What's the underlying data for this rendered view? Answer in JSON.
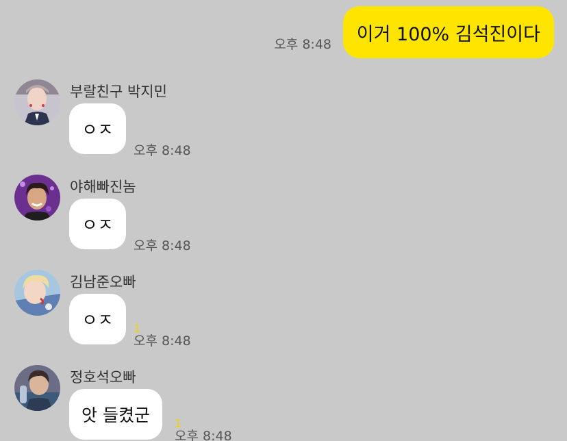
{
  "my_message": {
    "text": "이거 100% 김석진이다",
    "time": "오후 8:48"
  },
  "messages": [
    {
      "sender": "부랄친구 박지민",
      "text": "ㅇㅈ",
      "time": "오후 8:48",
      "unread": ""
    },
    {
      "sender": "야해빠진놈",
      "text": "ㅇㅈ",
      "time": "오후 8:48",
      "unread": ""
    },
    {
      "sender": "김남준오빠",
      "text": "ㅇㅈ",
      "time": "오후 8:48",
      "unread": "1"
    },
    {
      "sender": "정호석오빠",
      "text": "앗 들켰군",
      "time": "오후 8:48",
      "unread": "1"
    }
  ],
  "colors": {
    "background": "#c9c9c9",
    "my_bubble": "#fee500",
    "friend_bubble": "#ffffff",
    "unread": "#f2d200"
  }
}
